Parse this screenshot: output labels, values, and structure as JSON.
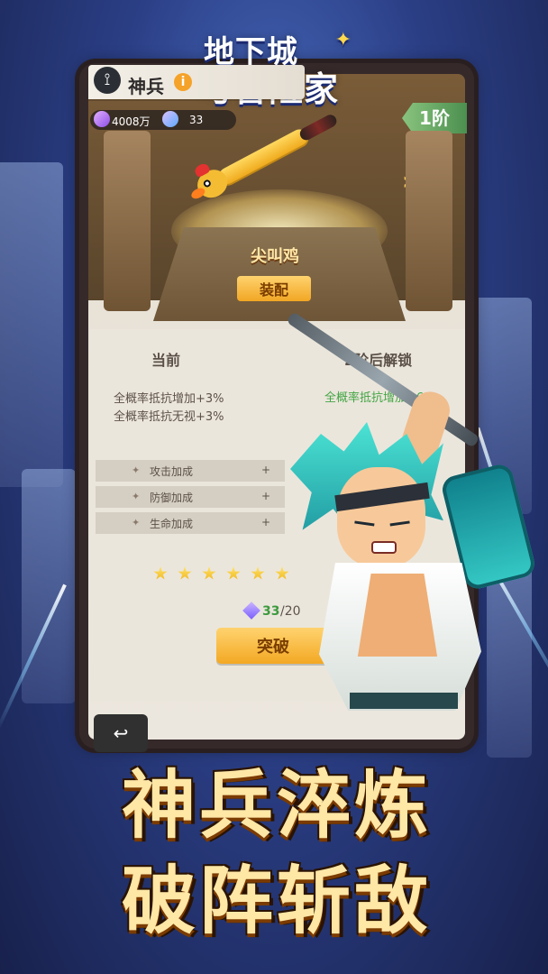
{
  "logo": {
    "line1": "地下城",
    "line2": "与冒险家"
  },
  "header": {
    "title": "神兵",
    "info_icon": "info-icon",
    "back_icon": "back-icon"
  },
  "resources": {
    "gold_value": "4008万",
    "crystal_value": "33"
  },
  "rank": {
    "label": "1阶"
  },
  "weapon": {
    "name": "尖叫鸡",
    "equip_label": "装配"
  },
  "stats": {
    "current_title": "当前",
    "unlock_title": "2阶后解锁",
    "current_effects": [
      "全概率抵抗增加+3%",
      "全概率抵抗无视+3%"
    ],
    "unlock_effects": [
      "全概率抵抗增加+6%"
    ],
    "bonus_rows": [
      {
        "label": "攻击加成",
        "value": "+"
      },
      {
        "label": "防御加成",
        "value": "+"
      },
      {
        "label": "生命加成",
        "value": "+"
      }
    ],
    "stars_filled": 6
  },
  "progress": {
    "current": "33",
    "required": "/20"
  },
  "actions": {
    "breakthrough_label": "突破",
    "back_label": "↩"
  },
  "promo": {
    "line1": "神兵淬炼",
    "line2": "破阵斩敌"
  }
}
